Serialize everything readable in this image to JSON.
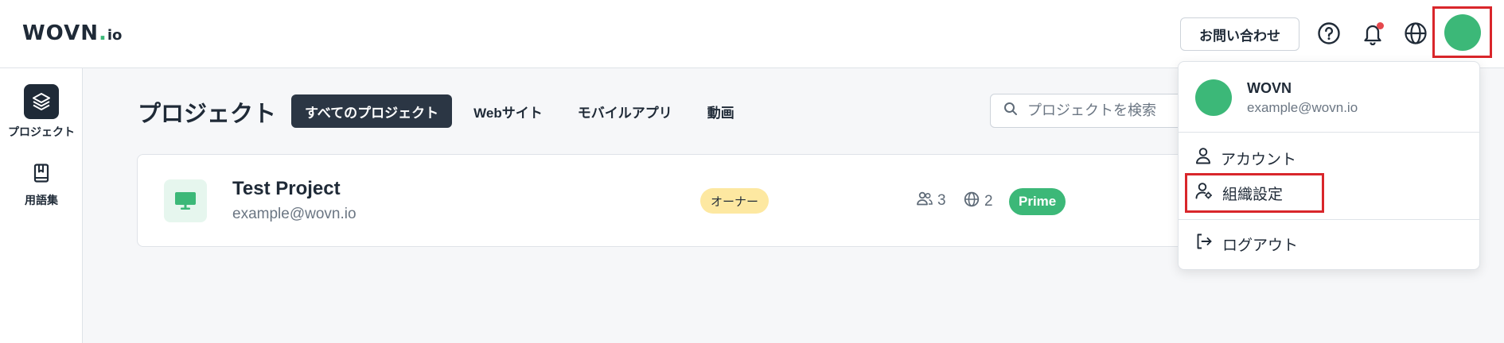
{
  "header": {
    "logo_main": "WOVN",
    "logo_dot": ".",
    "logo_suffix": "io",
    "contact_label": "お問い合わせ",
    "icons": [
      "help-icon",
      "bell-icon",
      "globe-icon"
    ]
  },
  "sidebar": {
    "items": [
      {
        "label": "プロジェクト",
        "icon": "layers-icon",
        "active": true
      },
      {
        "label": "用語集",
        "icon": "book-icon",
        "active": false
      }
    ]
  },
  "main": {
    "title": "プロジェクト",
    "tabs": [
      {
        "label": "すべてのプロジェクト",
        "active": true
      },
      {
        "label": "Webサイト",
        "active": false
      },
      {
        "label": "モバイルアプリ",
        "active": false
      },
      {
        "label": "動画",
        "active": false
      }
    ],
    "search_placeholder": "プロジェクトを検索"
  },
  "project": {
    "name": "Test Project",
    "email": "example@wovn.io",
    "role": "オーナー",
    "members": "3",
    "languages": "2",
    "plan": "Prime"
  },
  "menu": {
    "name": "WOVN",
    "email": "example@wovn.io",
    "items": [
      {
        "label": "アカウント",
        "icon": "user-icon"
      },
      {
        "label": "組織設定",
        "icon": "user-settings-icon"
      },
      {
        "label": "ログアウト",
        "icon": "logout-icon"
      }
    ]
  },
  "colors": {
    "brand_green": "#3cb878",
    "dark": "#1f2a37",
    "highlight_red": "#d9262b",
    "owner_badge": "#fde8a1"
  }
}
